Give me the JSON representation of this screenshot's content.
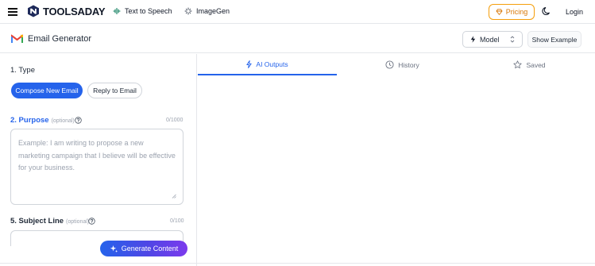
{
  "header": {
    "brand": "TOOLSADAY",
    "nav": [
      {
        "label": "Text to Speech",
        "icon": "waveform-icon"
      },
      {
        "label": "ImageGen",
        "icon": "sparkle-icon"
      }
    ],
    "pricing_label": "Pricing",
    "login_label": "Login"
  },
  "titlebar": {
    "title": "Email Generator",
    "model_label": "Model",
    "show_example_label": "Show Example"
  },
  "form": {
    "type": {
      "label": "1. Type",
      "options": [
        "Compose New Email",
        "Reply to Email"
      ],
      "selected": "Compose New Email"
    },
    "purpose": {
      "label": "2. Purpose",
      "optional": "(optional)",
      "counter": "0/1000",
      "placeholder": "Example: I am writing to propose a new marketing campaign that I believe will be effective for your business."
    },
    "subject": {
      "label": "5. Subject Line",
      "optional": "(optional)",
      "counter": "0/100"
    },
    "generate_label": "Generate Content"
  },
  "tabs": [
    {
      "label": "AI Outputs",
      "icon": "bolt-icon",
      "active": true
    },
    {
      "label": "History",
      "icon": "clock-icon",
      "active": false
    },
    {
      "label": "Saved",
      "icon": "star-icon",
      "active": false
    }
  ],
  "colors": {
    "accent": "#2563eb",
    "pricing": "#d97706",
    "gradient_end": "#7c3aed"
  }
}
